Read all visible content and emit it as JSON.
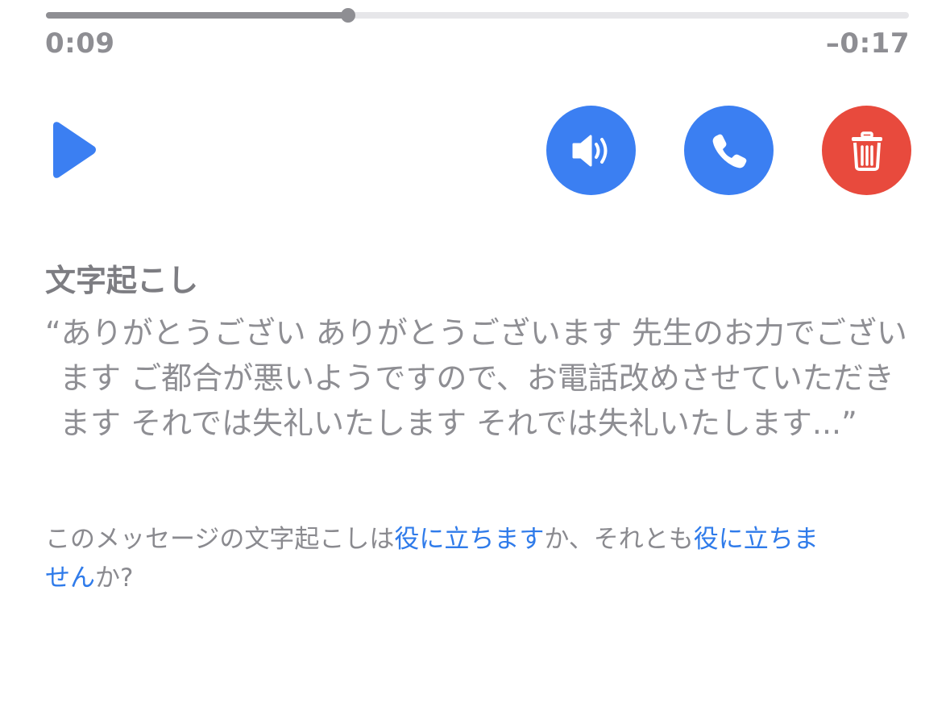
{
  "player": {
    "progress": 0.35,
    "elapsed": "0:09",
    "remaining": "–0:17",
    "play_icon": "play-icon"
  },
  "actions": {
    "speaker": {
      "icon": "speaker-icon",
      "color": "#3b7ff2"
    },
    "call": {
      "icon": "phone-icon",
      "color": "#3b7ff2"
    },
    "delete": {
      "icon": "trash-icon",
      "color": "#e84a3d"
    }
  },
  "transcription": {
    "title": "文字起こし",
    "text": "“ありがとうござい ありがとうございます 先生のお力でございます ご都合が悪いようですので、お電話改めさせていただきます それでは失礼いたします それでは失礼いたします...”"
  },
  "feedback": {
    "prefix": "このメッセージの文字起こしは",
    "useful_link": "役に立ちます",
    "middle": "か、それとも",
    "not_useful_link": "役に立ちません",
    "suffix": "か?"
  },
  "colors": {
    "accent": "#3b7ff2",
    "link": "#2f7bea",
    "destructive": "#e84a3d",
    "secondary_text": "#8e8e93"
  }
}
